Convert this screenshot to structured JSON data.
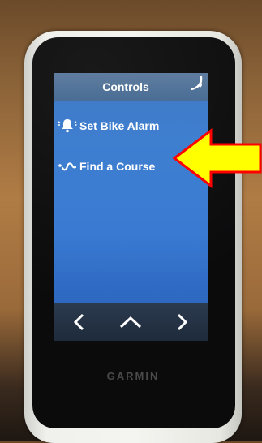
{
  "screen": {
    "title": "Controls",
    "menu_items": [
      {
        "label": "Set Bike Alarm",
        "icon": "bell-icon"
      },
      {
        "label": "Find a Course",
        "icon": "course-route-icon"
      }
    ],
    "nav": {
      "back_icon": "chevron-left-icon",
      "up_icon": "chevron-up-icon",
      "forward_icon": "chevron-right-icon"
    },
    "status_icon": "signal-icon"
  },
  "device": {
    "brand": "GARMIN"
  },
  "annotation": {
    "icon": "arrow-left-icon",
    "fill_color": "#ffff00",
    "stroke_color": "#ff0000"
  },
  "colors": {
    "screen_blue": "#3f7fd0",
    "header": "#4a6d95",
    "nav_bar": "#1e2b3c"
  }
}
